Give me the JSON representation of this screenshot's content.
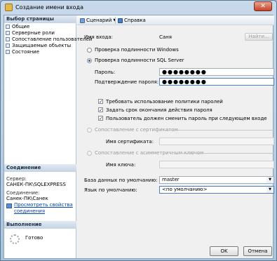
{
  "window": {
    "title": "Создание имени входа",
    "close_glyph": "✕"
  },
  "left_panel": {
    "pages_header": "Выбор страницы",
    "pages": [
      {
        "label": "Общие",
        "icon": "page-icon"
      },
      {
        "label": "Серверные роли",
        "icon": "page-icon"
      },
      {
        "label": "Сопоставление пользователей",
        "icon": "page-icon"
      },
      {
        "label": "Защищаемые объекты",
        "icon": "page-icon"
      },
      {
        "label": "Состояние",
        "icon": "page-icon"
      }
    ],
    "connection_header": "Соединение",
    "server_label": "Сервер:",
    "server_value": "САНЕК-ПК\\SQLEXPRESS",
    "connection_label": "Соединение:",
    "connection_value": "Санек-ПК\\Санек",
    "view_link_line1": "Просмотреть свойства",
    "view_link_line2": "соединения",
    "progress_header": "Выполнение",
    "progress_status": "Готово"
  },
  "toolbar": {
    "script_label": "Сценарий",
    "help_label": "Справка"
  },
  "form": {
    "login_name_label": "Имя входа:",
    "login_name_value": "Саня",
    "find_button": "Найти...",
    "windows_auth_label": "Проверка подлинности Windows",
    "sql_auth_label": "Проверка подлинности SQL Server",
    "password_label": "Пароль:",
    "password_value": "●●●●●●●●",
    "confirm_label": "Подтверждение пароля:",
    "confirm_value": "●●●●●●●●",
    "enforce_policy_label": "Требовать использование политики паролей",
    "enforce_expiration_label": "Задать срок окончания действия пароля",
    "must_change_label": "Пользователь должен сменить пароль при следующем входе",
    "cert_mapped_label": "Сопоставление с сертификатом",
    "cert_name_label": "Имя сертификата:",
    "key_mapped_label": "Сопоставление с асимметричным ключом",
    "key_name_label": "Имя ключа:",
    "default_db_label": "База данных по умолчанию:",
    "default_db_value": "master",
    "default_lang_label": "Язык по умолчанию:",
    "default_lang_value": "<по умолчанию>"
  },
  "footer": {
    "ok_label": "OK",
    "cancel_label": "Отмена"
  }
}
